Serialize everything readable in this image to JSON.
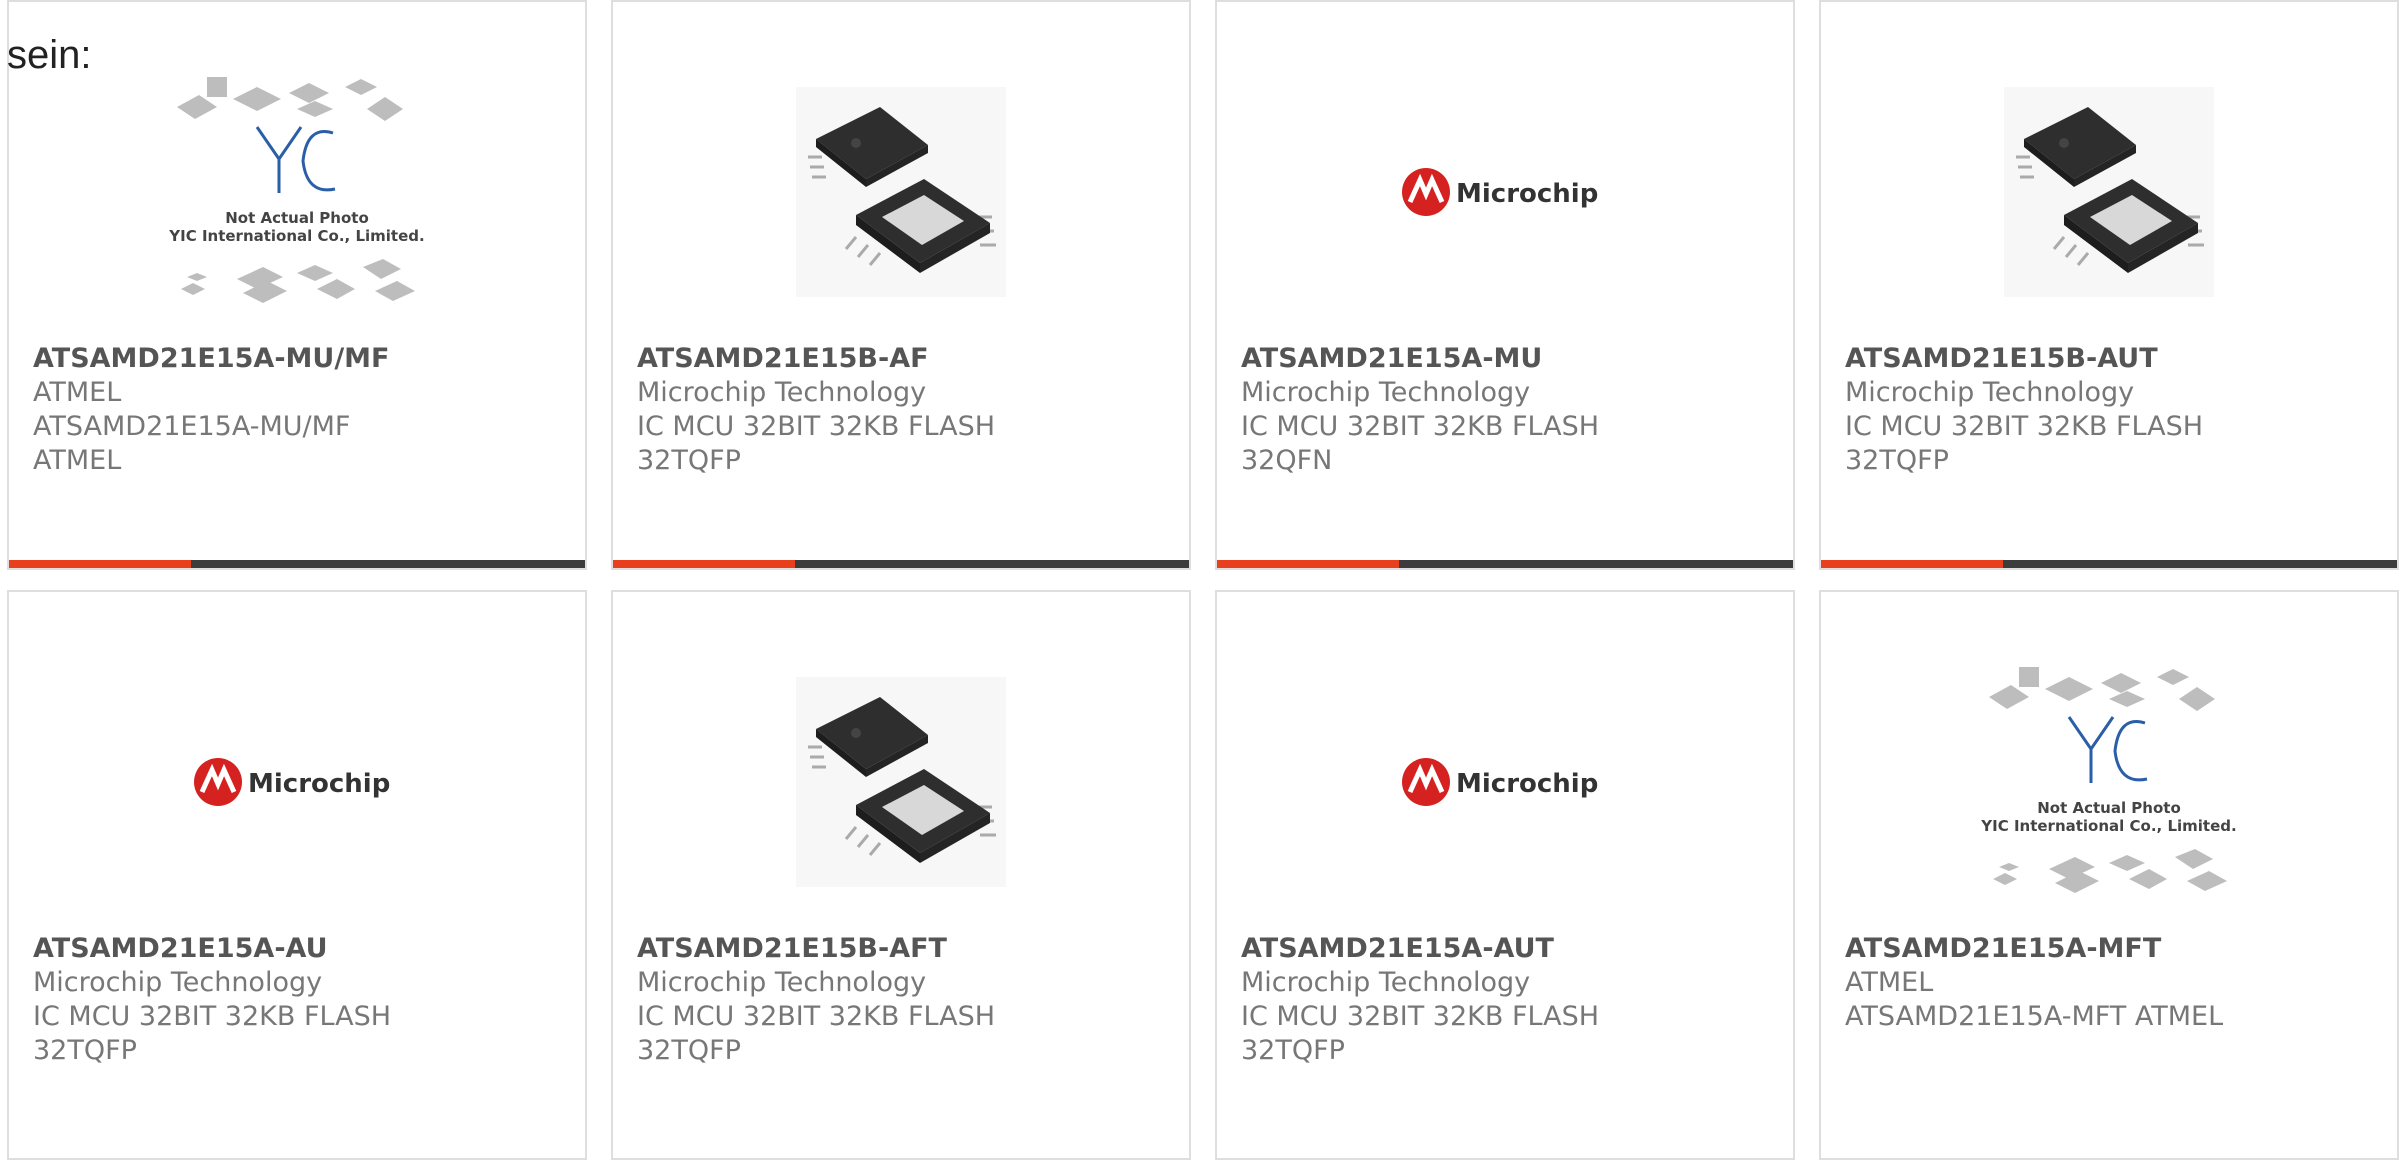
{
  "intro_text": "sein:",
  "colors": {
    "accent": "#e8401c",
    "bar": "#3c3c3c",
    "card_border": "#dedede",
    "microchip_red": "#d5211f",
    "yic_blue": "#2a5fa8"
  },
  "products": [
    {
      "part_number": "ATSAMD21E15A-MU/MF",
      "manufacturer": "ATMEL",
      "description": "ATSAMD21E15A-MU/MF ATMEL",
      "image": "yic-placeholder",
      "placeholder_line1": "Not Actual Photo",
      "placeholder_line2": "YIC International Co., Limited."
    },
    {
      "part_number": "ATSAMD21E15B-AF",
      "manufacturer": "Microchip Technology",
      "description": "IC MCU 32BIT 32KB FLASH 32TQFP",
      "image": "tqfp-chip"
    },
    {
      "part_number": "ATSAMD21E15A-MU",
      "manufacturer": "Microchip Technology",
      "description": "IC MCU 32BIT 32KB FLASH 32QFN",
      "image": "microchip-logo",
      "logo_text": "Microchip"
    },
    {
      "part_number": "ATSAMD21E15B-AUT",
      "manufacturer": "Microchip Technology",
      "description": "IC MCU 32BIT 32KB FLASH 32TQFP",
      "image": "tqfp-chip"
    },
    {
      "part_number": "ATSAMD21E15A-AU",
      "manufacturer": "Microchip Technology",
      "description": "IC MCU 32BIT 32KB FLASH 32TQFP",
      "image": "microchip-logo",
      "logo_text": "Microchip"
    },
    {
      "part_number": "ATSAMD21E15B-AFT",
      "manufacturer": "Microchip Technology",
      "description": "IC MCU 32BIT 32KB FLASH 32TQFP",
      "image": "tqfp-chip"
    },
    {
      "part_number": "ATSAMD21E15A-AUT",
      "manufacturer": "Microchip Technology",
      "description": "IC MCU 32BIT 32KB FLASH 32TQFP",
      "image": "microchip-logo",
      "logo_text": "Microchip"
    },
    {
      "part_number": "ATSAMD21E15A-MFT",
      "manufacturer": "ATMEL",
      "description": "ATSAMD21E15A-MFT ATMEL",
      "image": "yic-placeholder",
      "placeholder_line1": "Not Actual Photo",
      "placeholder_line2": "YIC International Co., Limited."
    }
  ]
}
